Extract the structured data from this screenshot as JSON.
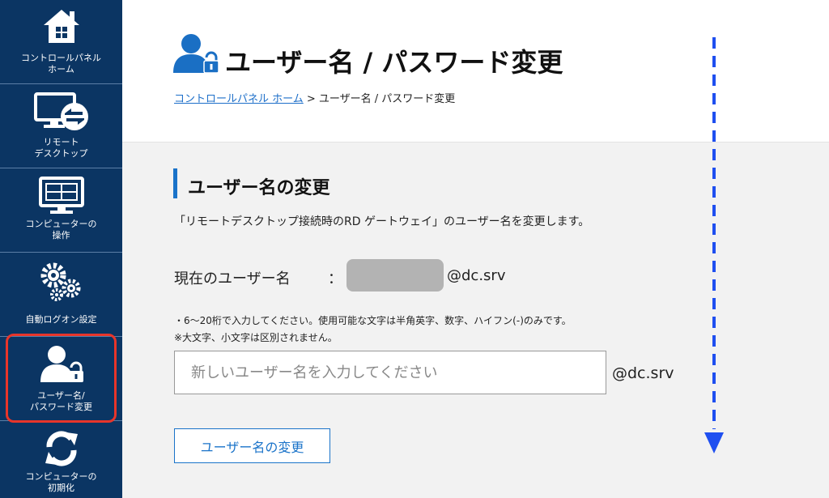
{
  "sidebar": {
    "items": [
      {
        "line1": "コントロールパネル",
        "line2": "ホーム",
        "icon": "home-icon"
      },
      {
        "line1": "リモート",
        "line2": "デスクトップ",
        "icon": "remote-desktop-icon"
      },
      {
        "line1": "コンピューターの",
        "line2": "操作",
        "icon": "computer-icon"
      },
      {
        "line1": "自動ログオン設定",
        "line2": "",
        "icon": "gears-icon"
      },
      {
        "line1": "ユーザー名/",
        "line2": "パスワード変更",
        "icon": "user-lock-icon"
      },
      {
        "line1": "コンピューターの",
        "line2": "初期化",
        "icon": "refresh-icon"
      }
    ],
    "active_index": 4,
    "highlight_color": "#e8352a",
    "background": "#0b3563"
  },
  "header": {
    "title": "ユーザー名 / パスワード変更",
    "breadcrumb_link": "コントロールパネル ホーム",
    "breadcrumb_separator": " > ",
    "breadcrumb_current": "ユーザー名 / パスワード変更"
  },
  "section": {
    "title": "ユーザー名の変更",
    "description": "「リモートデスクトップ接続時のRD ゲートウェイ」のユーザー名を変更します。",
    "current_label": "現在のユーザー名",
    "colon": "：",
    "current_domain": "@dc.srv",
    "note1": "・6〜20桁で入力してください。使用可能な文字は半角英字、数字、ハイフン(-)のみです。",
    "note2": "※大文字、小文字は区別されません。",
    "input_placeholder": "新しいユーザー名を入力してください",
    "input_value": "",
    "input_domain": "@dc.srv",
    "submit_label": "ユーザー名の変更"
  },
  "colors": {
    "accent": "#1a73c9",
    "scroll_arrow": "#1f4ff0"
  }
}
